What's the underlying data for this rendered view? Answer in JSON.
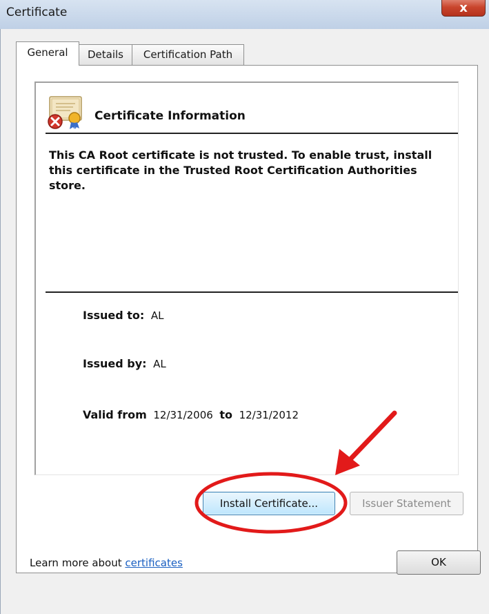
{
  "window": {
    "title": "Certificate",
    "close_glyph": "x"
  },
  "tabs": [
    {
      "label": "General",
      "active": true
    },
    {
      "label": "Details",
      "active": false
    },
    {
      "label": "Certification Path",
      "active": false
    }
  ],
  "general": {
    "heading": "Certificate Information",
    "status_message": "This CA Root certificate is not trusted. To enable trust, install this certificate in the Trusted Root Certification Authorities store.",
    "issued_to_label": "Issued to:",
    "issued_to_value": "AL",
    "issued_by_label": "Issued by:",
    "issued_by_value": "AL",
    "valid_from_label": "Valid from",
    "valid_from_value": "12/31/2006",
    "valid_to_label": "to",
    "valid_to_value": "12/31/2012"
  },
  "buttons": {
    "install": "Install Certificate...",
    "issuer_statement": "Issuer Statement",
    "ok": "OK"
  },
  "learn_more": {
    "prefix": "Learn more about ",
    "link": "certificates"
  },
  "icons": {
    "certificate": "certificate-untrusted-icon"
  },
  "colors": {
    "annotation": "#e21a1a",
    "link": "#1a5fc1"
  }
}
